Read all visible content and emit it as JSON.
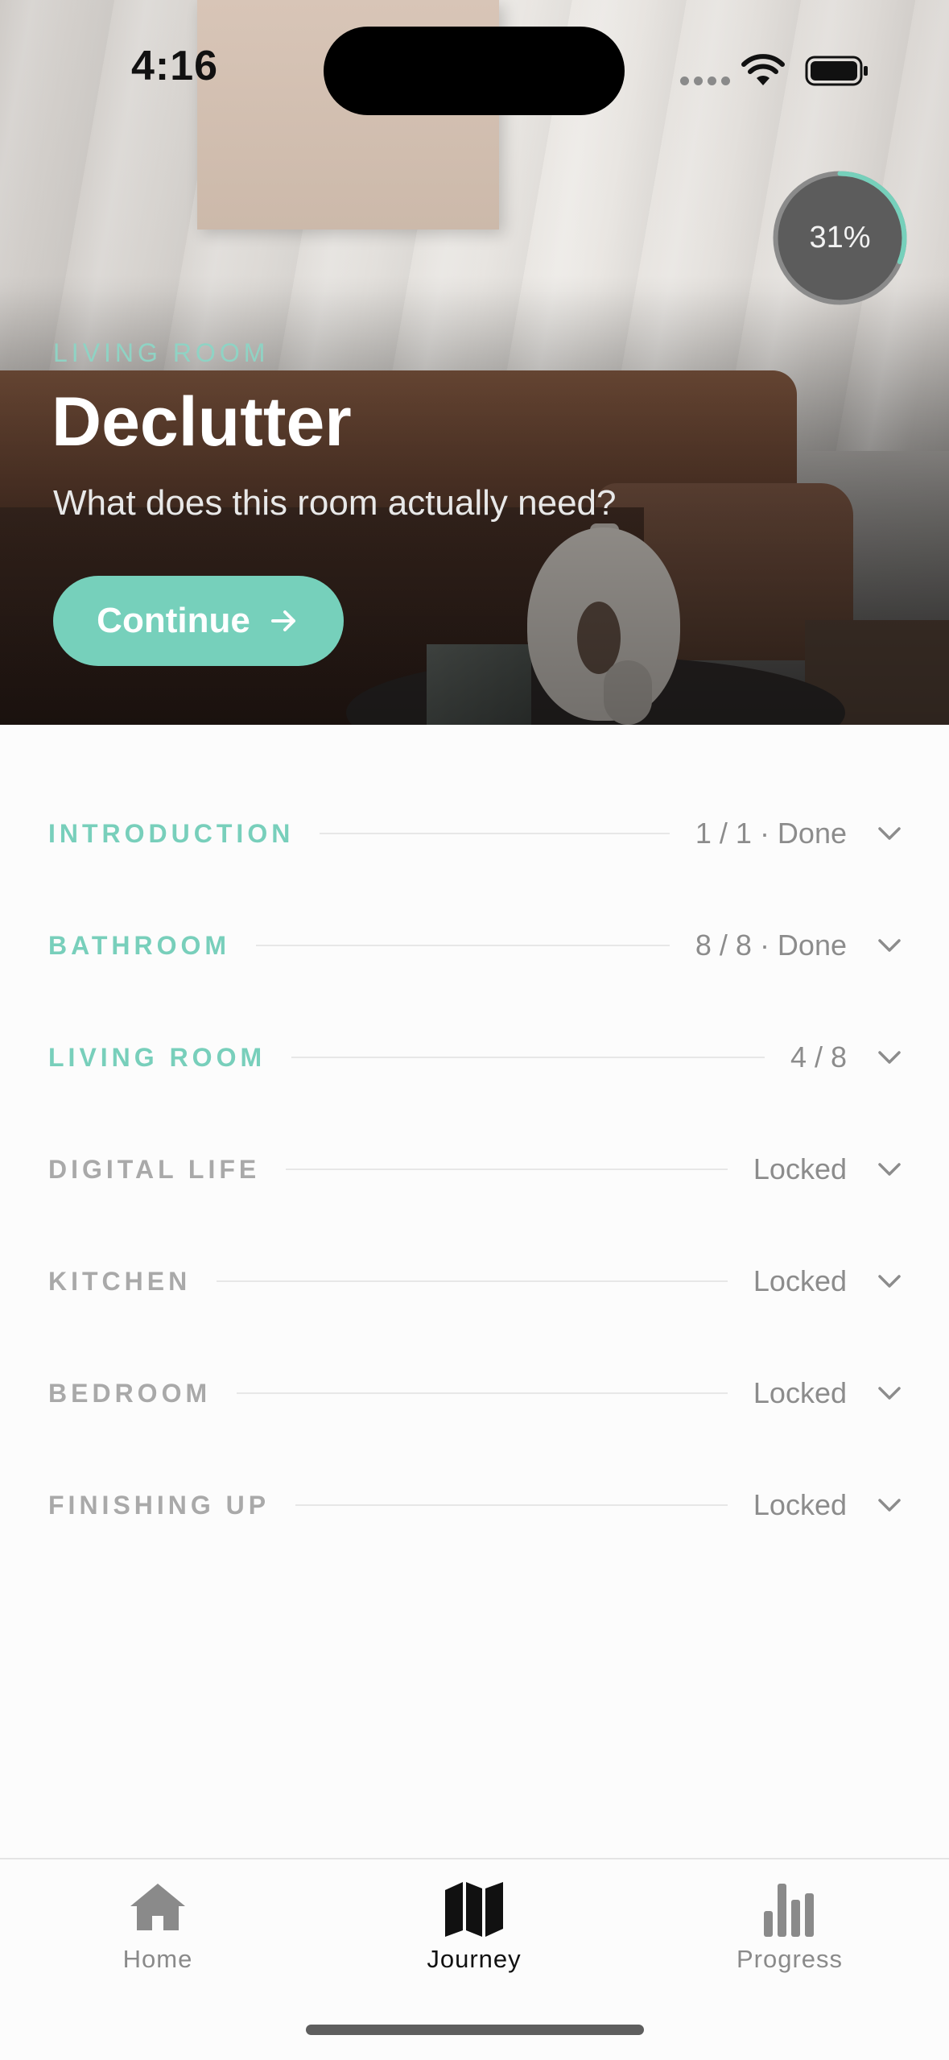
{
  "status_bar": {
    "time": "4:16"
  },
  "hero": {
    "progress_percent": 31,
    "progress_label": "31%",
    "eyebrow": "LIVING ROOM",
    "title": "Declutter",
    "subtitle": "What does this room actually need?",
    "continue_label": "Continue",
    "accent_color": "#76d0bb"
  },
  "sections": [
    {
      "name": "INTRODUCTION",
      "status": "1 / 1 · Done",
      "state": "active"
    },
    {
      "name": "BATHROOM",
      "status": "8 / 8 · Done",
      "state": "active"
    },
    {
      "name": "LIVING ROOM",
      "status": "4 / 8",
      "state": "active"
    },
    {
      "name": "DIGITAL LIFE",
      "status": "Locked",
      "state": "locked"
    },
    {
      "name": "KITCHEN",
      "status": "Locked",
      "state": "locked"
    },
    {
      "name": "BEDROOM",
      "status": "Locked",
      "state": "locked"
    },
    {
      "name": "FINISHING UP",
      "status": "Locked",
      "state": "locked"
    }
  ],
  "tabs": [
    {
      "label": "Home",
      "icon": "home-icon",
      "active": false
    },
    {
      "label": "Journey",
      "icon": "map-icon",
      "active": true
    },
    {
      "label": "Progress",
      "icon": "bar-chart-icon",
      "active": false
    }
  ]
}
